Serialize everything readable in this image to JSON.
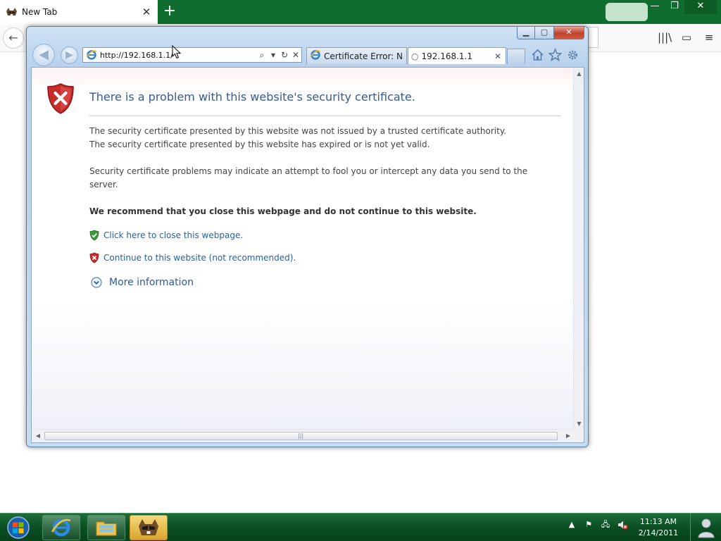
{
  "firefox": {
    "tab_title": "New Tab",
    "tab_close": "✕",
    "new_tab": "+",
    "caption": {
      "minimize": "—",
      "maximize": "❐",
      "close": "✕"
    },
    "toolbar": {
      "back": "←",
      "library": "|||\\",
      "sidebar": "▭",
      "menu": "≡"
    }
  },
  "ie": {
    "caption": {
      "minimize": "▁",
      "maximize": "▢",
      "close": "✕"
    },
    "back": "◀",
    "forward": "▶",
    "address": {
      "url": "http://192.168.1.1/",
      "search": "⌕",
      "dropdown": "▾",
      "refresh": "↻",
      "stop": "✕"
    },
    "tabs": [
      {
        "label": "Certificate Error: Na..."
      },
      {
        "label": "192.168.1.1",
        "close": "✕",
        "loading": "○"
      }
    ],
    "page": {
      "title": "There is a problem with this website's security certificate.",
      "line1": "The security certificate presented by this website was not issued by a trusted certificate authority.",
      "line2": "The security certificate presented by this website has expired or is not yet valid.",
      "line3": "Security certificate problems may indicate an attempt to fool you or intercept any data you send to the server.",
      "recommend": "We recommend that you close this webpage and do not continue to this website.",
      "close_link": "Click here to close this webpage.",
      "continue_link": "Continue to this website (not recommended).",
      "more_info": "More information"
    },
    "scroll": {
      "up": "▲",
      "down": "▼",
      "left": "◀",
      "right": "▶",
      "grip": "|||"
    }
  },
  "taskbar": {
    "tray": {
      "arrow": "▲",
      "flag": "⚑",
      "network": "🖧",
      "volume": "🔈"
    },
    "clock_time": "11:13 AM",
    "clock_date": "2/14/2011"
  },
  "colors": {
    "ie_title": "#385b8f",
    "link": "#1f62a8",
    "taskbar": "#0b4f23",
    "firefox_tabstrip": "#0f6e2f"
  },
  "icons": {
    "shield_error": "shield-error-icon",
    "shield_ok": "shield-check-icon",
    "ie_logo": "ie-icon",
    "firefox_logo": "raccoon-favicon-icon"
  }
}
